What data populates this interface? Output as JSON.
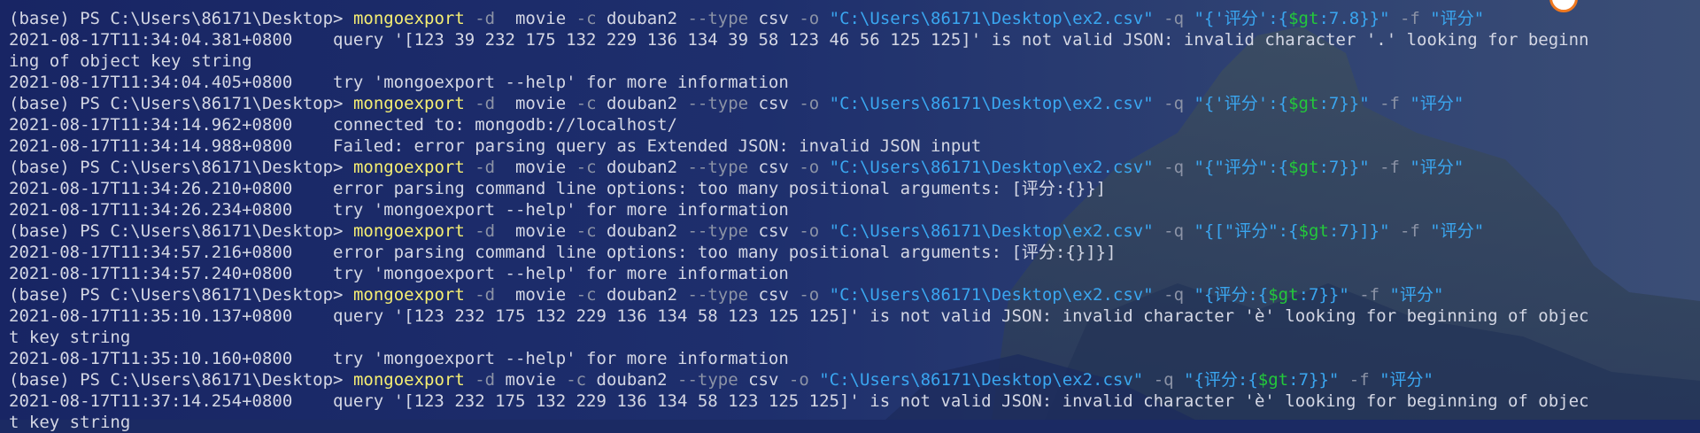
{
  "prompt": "(base) PS C:\\Users\\86171\\Desktop> ",
  "lines": [
    {
      "type": "cmd",
      "segments": [
        {
          "t": "mongoexport",
          "c": "y"
        },
        {
          "t": " -d ",
          "c": "g"
        },
        {
          "t": " movie ",
          "c": "w"
        },
        {
          "t": "-c ",
          "c": "g"
        },
        {
          "t": "douban2 ",
          "c": "w"
        },
        {
          "t": "--type ",
          "c": "g"
        },
        {
          "t": "csv ",
          "c": "w"
        },
        {
          "t": "-o ",
          "c": "g"
        },
        {
          "t": "\"C:\\Users\\86171\\Desktop\\ex2.csv\" ",
          "c": "b"
        },
        {
          "t": "-q ",
          "c": "g"
        },
        {
          "t": "\"{'评分':{",
          "c": "b"
        },
        {
          "t": "$gt",
          "c": "gr"
        },
        {
          "t": ":7.8}}\" ",
          "c": "b"
        },
        {
          "t": "-f ",
          "c": "g"
        },
        {
          "t": "\"评分\"",
          "c": "b"
        }
      ]
    },
    {
      "type": "out",
      "text": "2021-08-17T11:34:04.381+0800    query '[123 39 232 175 132 229 136 134 39 58 123 46 56 125 125]' is not valid JSON: invalid character '.' looking for beginn"
    },
    {
      "type": "out",
      "text": "ing of object key string"
    },
    {
      "type": "out",
      "text": "2021-08-17T11:34:04.405+0800    try 'mongoexport --help' for more information"
    },
    {
      "type": "cmd",
      "segments": [
        {
          "t": "mongoexport",
          "c": "y"
        },
        {
          "t": " -d ",
          "c": "g"
        },
        {
          "t": " movie ",
          "c": "w"
        },
        {
          "t": "-c ",
          "c": "g"
        },
        {
          "t": "douban2 ",
          "c": "w"
        },
        {
          "t": "--type ",
          "c": "g"
        },
        {
          "t": "csv ",
          "c": "w"
        },
        {
          "t": "-o ",
          "c": "g"
        },
        {
          "t": "\"C:\\Users\\86171\\Desktop\\ex2.csv\" ",
          "c": "b"
        },
        {
          "t": "-q ",
          "c": "g"
        },
        {
          "t": "\"{'评分':{",
          "c": "b"
        },
        {
          "t": "$gt",
          "c": "gr"
        },
        {
          "t": ":7}}\" ",
          "c": "b"
        },
        {
          "t": "-f ",
          "c": "g"
        },
        {
          "t": "\"评分\"",
          "c": "b"
        }
      ]
    },
    {
      "type": "out",
      "text": "2021-08-17T11:34:14.962+0800    connected to: mongodb://localhost/"
    },
    {
      "type": "out",
      "text": "2021-08-17T11:34:14.988+0800    Failed: error parsing query as Extended JSON: invalid JSON input"
    },
    {
      "type": "cmd",
      "segments": [
        {
          "t": "mongoexport",
          "c": "y"
        },
        {
          "t": " -d ",
          "c": "g"
        },
        {
          "t": " movie ",
          "c": "w"
        },
        {
          "t": "-c ",
          "c": "g"
        },
        {
          "t": "douban2 ",
          "c": "w"
        },
        {
          "t": "--type ",
          "c": "g"
        },
        {
          "t": "csv ",
          "c": "w"
        },
        {
          "t": "-o ",
          "c": "g"
        },
        {
          "t": "\"C:\\Users\\86171\\Desktop\\ex2.csv\" ",
          "c": "b"
        },
        {
          "t": "-q ",
          "c": "g"
        },
        {
          "t": "\"{\"评分\":{",
          "c": "b"
        },
        {
          "t": "$gt",
          "c": "gr"
        },
        {
          "t": ":7}}\" ",
          "c": "b"
        },
        {
          "t": "-f ",
          "c": "g"
        },
        {
          "t": "\"评分\"",
          "c": "b"
        }
      ]
    },
    {
      "type": "out",
      "text": "2021-08-17T11:34:26.210+0800    error parsing command line options: too many positional arguments: [评分:{}}]"
    },
    {
      "type": "out",
      "text": "2021-08-17T11:34:26.234+0800    try 'mongoexport --help' for more information"
    },
    {
      "type": "cmd",
      "segments": [
        {
          "t": "mongoexport",
          "c": "y"
        },
        {
          "t": " -d ",
          "c": "g"
        },
        {
          "t": " movie ",
          "c": "w"
        },
        {
          "t": "-c ",
          "c": "g"
        },
        {
          "t": "douban2 ",
          "c": "w"
        },
        {
          "t": "--type ",
          "c": "g"
        },
        {
          "t": "csv ",
          "c": "w"
        },
        {
          "t": "-o ",
          "c": "g"
        },
        {
          "t": "\"C:\\Users\\86171\\Desktop\\ex2.csv\" ",
          "c": "b"
        },
        {
          "t": "-q ",
          "c": "g"
        },
        {
          "t": "\"{[\"评分\":{",
          "c": "b"
        },
        {
          "t": "$gt",
          "c": "gr"
        },
        {
          "t": ":7}]}\" ",
          "c": "b"
        },
        {
          "t": "-f ",
          "c": "g"
        },
        {
          "t": "\"评分\"",
          "c": "b"
        }
      ]
    },
    {
      "type": "out",
      "text": "2021-08-17T11:34:57.216+0800    error parsing command line options: too many positional arguments: [评分:{}]}]"
    },
    {
      "type": "out",
      "text": "2021-08-17T11:34:57.240+0800    try 'mongoexport --help' for more information"
    },
    {
      "type": "cmd",
      "segments": [
        {
          "t": "mongoexport",
          "c": "y"
        },
        {
          "t": " -d ",
          "c": "g"
        },
        {
          "t": " movie ",
          "c": "w"
        },
        {
          "t": "-c ",
          "c": "g"
        },
        {
          "t": "douban2 ",
          "c": "w"
        },
        {
          "t": "--type ",
          "c": "g"
        },
        {
          "t": "csv ",
          "c": "w"
        },
        {
          "t": "-o ",
          "c": "g"
        },
        {
          "t": "\"C:\\Users\\86171\\Desktop\\ex2.csv\" ",
          "c": "b"
        },
        {
          "t": "-q ",
          "c": "g"
        },
        {
          "t": "\"{评分:{",
          "c": "b"
        },
        {
          "t": "$gt",
          "c": "gr"
        },
        {
          "t": ":7}}\" ",
          "c": "b"
        },
        {
          "t": "-f ",
          "c": "g"
        },
        {
          "t": "\"评分\"",
          "c": "b"
        }
      ]
    },
    {
      "type": "out",
      "text": "2021-08-17T11:35:10.137+0800    query '[123 232 175 132 229 136 134 58 123 125 125]' is not valid JSON: invalid character 'è' looking for beginning of objec"
    },
    {
      "type": "out",
      "text": "t key string"
    },
    {
      "type": "out",
      "text": "2021-08-17T11:35:10.160+0800    try 'mongoexport --help' for more information"
    },
    {
      "type": "cmd",
      "segments": [
        {
          "t": "mongoexport",
          "c": "y"
        },
        {
          "t": " -d ",
          "c": "g"
        },
        {
          "t": "movie ",
          "c": "w"
        },
        {
          "t": "-c ",
          "c": "g"
        },
        {
          "t": "douban2 ",
          "c": "w"
        },
        {
          "t": "--type ",
          "c": "g"
        },
        {
          "t": "csv ",
          "c": "w"
        },
        {
          "t": "-o ",
          "c": "g"
        },
        {
          "t": "\"C:\\Users\\86171\\Desktop\\ex2.csv\" ",
          "c": "b"
        },
        {
          "t": "-q ",
          "c": "g"
        },
        {
          "t": "\"{评分:{",
          "c": "b"
        },
        {
          "t": "$gt",
          "c": "gr"
        },
        {
          "t": ":7}}\" ",
          "c": "b"
        },
        {
          "t": "-f ",
          "c": "g"
        },
        {
          "t": "\"评分\"",
          "c": "b"
        }
      ]
    },
    {
      "type": "out",
      "text": "2021-08-17T11:37:14.254+0800    query '[123 232 175 132 229 136 134 58 123 125 125]' is not valid JSON: invalid character 'è' looking for beginning of objec"
    },
    {
      "type": "out",
      "text": "t key string"
    }
  ]
}
